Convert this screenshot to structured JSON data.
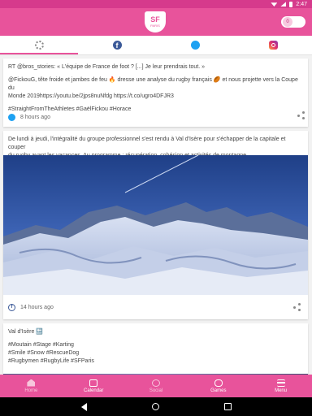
{
  "status_bar": {
    "time": "2:47"
  },
  "header": {
    "logo_text": "SF",
    "logo_sub": "PARIS",
    "points_value": "0"
  },
  "tabs": [
    {
      "name": "all",
      "icon": "all-sources-icon"
    },
    {
      "name": "facebook",
      "icon": "facebook-icon"
    },
    {
      "name": "twitter",
      "icon": "twitter-icon"
    },
    {
      "name": "instagram",
      "icon": "instagram-icon"
    }
  ],
  "posts": [
    {
      "source": "twitter",
      "lines": [
        "RT @bros_stories: « L'équipe de France de foot ? [...] Je leur prendrais tout. »",
        "",
        "@FickouG, tête froide et jambes de feu 🔥 dresse une analyse du rugby français 🏉 et nous projette vers la Coupe du",
        "Monde 2019https://youtu.be/2jps8nuNfdg https://t.co/ugro4DFJR3",
        "",
        "#StraightFromTheAthletes #GaëlFickou #Horace"
      ],
      "time": "8 hours ago"
    },
    {
      "source": "facebook",
      "lines": [
        "De lundi à jeudi, l'intégralité du groupe professionnel s'est rendu à Val d'Isère pour s'échapper de la capitale et couper",
        "du rugby avant les vacances. Au programme : récupération, cohésion et activités de montagne."
      ],
      "time": "14 hours ago"
    },
    {
      "source": "instagram",
      "lines": [
        "Val d'Isère 🔙",
        "",
        "#Moutain #Stage #Karting",
        "#Smile #Snow #RescueDog",
        "#Rugbymen #RugbyLife #SFParis"
      ]
    }
  ],
  "bottom_nav": [
    {
      "label": "Home",
      "icon": "home-icon"
    },
    {
      "label": "Calendar",
      "icon": "calendar-icon"
    },
    {
      "label": "Social",
      "icon": "social-icon"
    },
    {
      "label": "Games",
      "icon": "games-icon"
    },
    {
      "label": "Menu",
      "icon": "menu-icon"
    }
  ],
  "colors": {
    "brand": "#e8539b",
    "status": "#d63a8c"
  }
}
